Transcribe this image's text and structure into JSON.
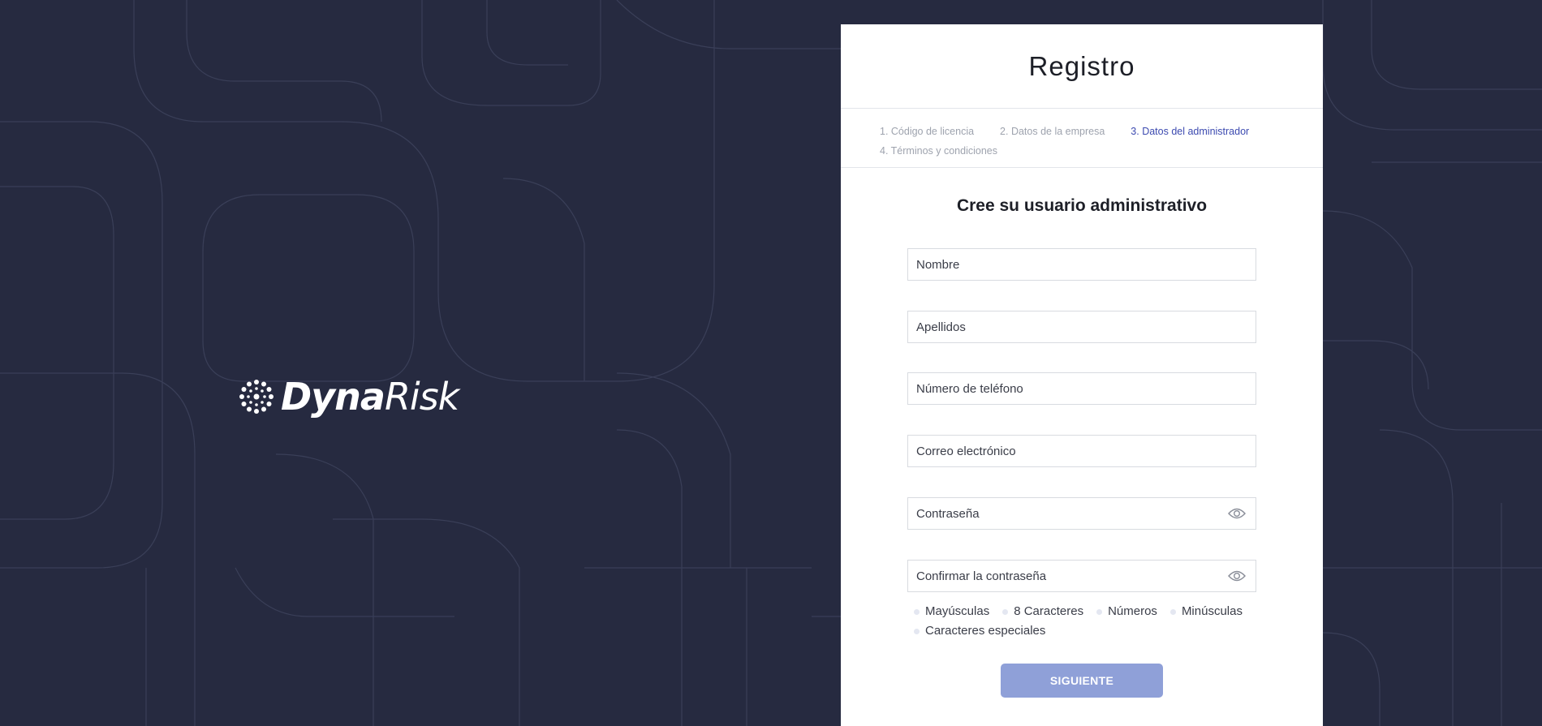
{
  "brand": {
    "name_bold": "Dyna",
    "name_light": "Risk"
  },
  "panel": {
    "title": "Registro",
    "steps": [
      {
        "label": "1. Código de licencia",
        "state": "inactive"
      },
      {
        "label": "2. Datos de la empresa",
        "state": "inactive"
      },
      {
        "label": "3. Datos del administrador",
        "state": "active"
      },
      {
        "label": "4. Términos y condiciones",
        "state": "inactive"
      }
    ],
    "form_title": "Cree su usuario administrativo",
    "fields": {
      "first_name": {
        "placeholder": "Nombre",
        "value": ""
      },
      "last_name": {
        "placeholder": "Apellidos",
        "value": ""
      },
      "phone": {
        "placeholder": "Número de teléfono",
        "value": ""
      },
      "email": {
        "placeholder": "Correo electrónico",
        "value": ""
      },
      "password": {
        "placeholder": "Contraseña",
        "value": ""
      },
      "confirm_password": {
        "placeholder": "Confirmar la contraseña",
        "value": ""
      }
    },
    "password_requirements": [
      "Mayúsculas",
      "8 Caracteres",
      "Números",
      "Minúsculas",
      "Caracteres especiales"
    ],
    "next_button": "SIGUIENTE"
  },
  "colors": {
    "background": "#262a40",
    "accent_active_step": "#3c4ab0",
    "button": "#8fa0d8",
    "requirement_dot": "#e4e7f1"
  },
  "icons": {
    "password_toggle": "eye-icon",
    "logo": "dynarisk-logo-icon"
  }
}
